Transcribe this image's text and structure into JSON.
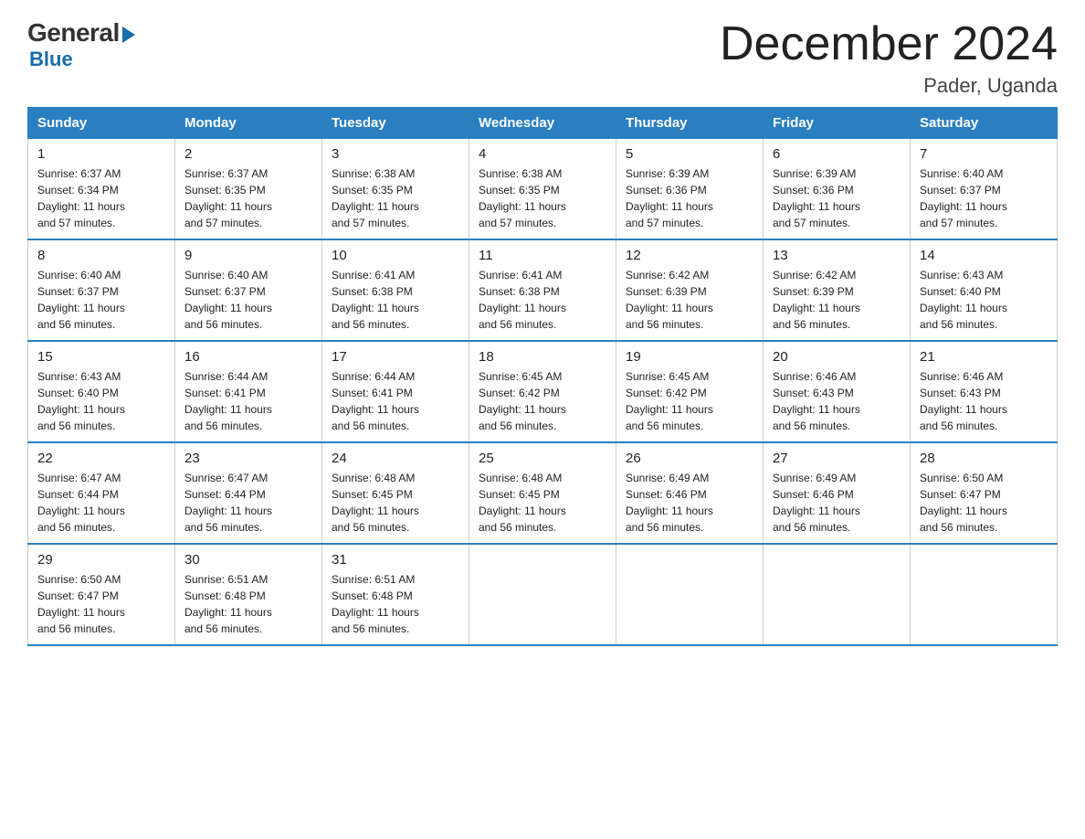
{
  "logo": {
    "general": "General",
    "blue": "Blue"
  },
  "title": "December 2024",
  "location": "Pader, Uganda",
  "days_of_week": [
    "Sunday",
    "Monday",
    "Tuesday",
    "Wednesday",
    "Thursday",
    "Friday",
    "Saturday"
  ],
  "weeks": [
    [
      {
        "day": "1",
        "sunrise": "6:37 AM",
        "sunset": "6:34 PM",
        "daylight": "11 hours and 57 minutes."
      },
      {
        "day": "2",
        "sunrise": "6:37 AM",
        "sunset": "6:35 PM",
        "daylight": "11 hours and 57 minutes."
      },
      {
        "day": "3",
        "sunrise": "6:38 AM",
        "sunset": "6:35 PM",
        "daylight": "11 hours and 57 minutes."
      },
      {
        "day": "4",
        "sunrise": "6:38 AM",
        "sunset": "6:35 PM",
        "daylight": "11 hours and 57 minutes."
      },
      {
        "day": "5",
        "sunrise": "6:39 AM",
        "sunset": "6:36 PM",
        "daylight": "11 hours and 57 minutes."
      },
      {
        "day": "6",
        "sunrise": "6:39 AM",
        "sunset": "6:36 PM",
        "daylight": "11 hours and 57 minutes."
      },
      {
        "day": "7",
        "sunrise": "6:40 AM",
        "sunset": "6:37 PM",
        "daylight": "11 hours and 57 minutes."
      }
    ],
    [
      {
        "day": "8",
        "sunrise": "6:40 AM",
        "sunset": "6:37 PM",
        "daylight": "11 hours and 56 minutes."
      },
      {
        "day": "9",
        "sunrise": "6:40 AM",
        "sunset": "6:37 PM",
        "daylight": "11 hours and 56 minutes."
      },
      {
        "day": "10",
        "sunrise": "6:41 AM",
        "sunset": "6:38 PM",
        "daylight": "11 hours and 56 minutes."
      },
      {
        "day": "11",
        "sunrise": "6:41 AM",
        "sunset": "6:38 PM",
        "daylight": "11 hours and 56 minutes."
      },
      {
        "day": "12",
        "sunrise": "6:42 AM",
        "sunset": "6:39 PM",
        "daylight": "11 hours and 56 minutes."
      },
      {
        "day": "13",
        "sunrise": "6:42 AM",
        "sunset": "6:39 PM",
        "daylight": "11 hours and 56 minutes."
      },
      {
        "day": "14",
        "sunrise": "6:43 AM",
        "sunset": "6:40 PM",
        "daylight": "11 hours and 56 minutes."
      }
    ],
    [
      {
        "day": "15",
        "sunrise": "6:43 AM",
        "sunset": "6:40 PM",
        "daylight": "11 hours and 56 minutes."
      },
      {
        "day": "16",
        "sunrise": "6:44 AM",
        "sunset": "6:41 PM",
        "daylight": "11 hours and 56 minutes."
      },
      {
        "day": "17",
        "sunrise": "6:44 AM",
        "sunset": "6:41 PM",
        "daylight": "11 hours and 56 minutes."
      },
      {
        "day": "18",
        "sunrise": "6:45 AM",
        "sunset": "6:42 PM",
        "daylight": "11 hours and 56 minutes."
      },
      {
        "day": "19",
        "sunrise": "6:45 AM",
        "sunset": "6:42 PM",
        "daylight": "11 hours and 56 minutes."
      },
      {
        "day": "20",
        "sunrise": "6:46 AM",
        "sunset": "6:43 PM",
        "daylight": "11 hours and 56 minutes."
      },
      {
        "day": "21",
        "sunrise": "6:46 AM",
        "sunset": "6:43 PM",
        "daylight": "11 hours and 56 minutes."
      }
    ],
    [
      {
        "day": "22",
        "sunrise": "6:47 AM",
        "sunset": "6:44 PM",
        "daylight": "11 hours and 56 minutes."
      },
      {
        "day": "23",
        "sunrise": "6:47 AM",
        "sunset": "6:44 PM",
        "daylight": "11 hours and 56 minutes."
      },
      {
        "day": "24",
        "sunrise": "6:48 AM",
        "sunset": "6:45 PM",
        "daylight": "11 hours and 56 minutes."
      },
      {
        "day": "25",
        "sunrise": "6:48 AM",
        "sunset": "6:45 PM",
        "daylight": "11 hours and 56 minutes."
      },
      {
        "day": "26",
        "sunrise": "6:49 AM",
        "sunset": "6:46 PM",
        "daylight": "11 hours and 56 minutes."
      },
      {
        "day": "27",
        "sunrise": "6:49 AM",
        "sunset": "6:46 PM",
        "daylight": "11 hours and 56 minutes."
      },
      {
        "day": "28",
        "sunrise": "6:50 AM",
        "sunset": "6:47 PM",
        "daylight": "11 hours and 56 minutes."
      }
    ],
    [
      {
        "day": "29",
        "sunrise": "6:50 AM",
        "sunset": "6:47 PM",
        "daylight": "11 hours and 56 minutes."
      },
      {
        "day": "30",
        "sunrise": "6:51 AM",
        "sunset": "6:48 PM",
        "daylight": "11 hours and 56 minutes."
      },
      {
        "day": "31",
        "sunrise": "6:51 AM",
        "sunset": "6:48 PM",
        "daylight": "11 hours and 56 minutes."
      },
      null,
      null,
      null,
      null
    ]
  ],
  "labels": {
    "sunrise": "Sunrise:",
    "sunset": "Sunset:",
    "daylight": "Daylight:"
  }
}
